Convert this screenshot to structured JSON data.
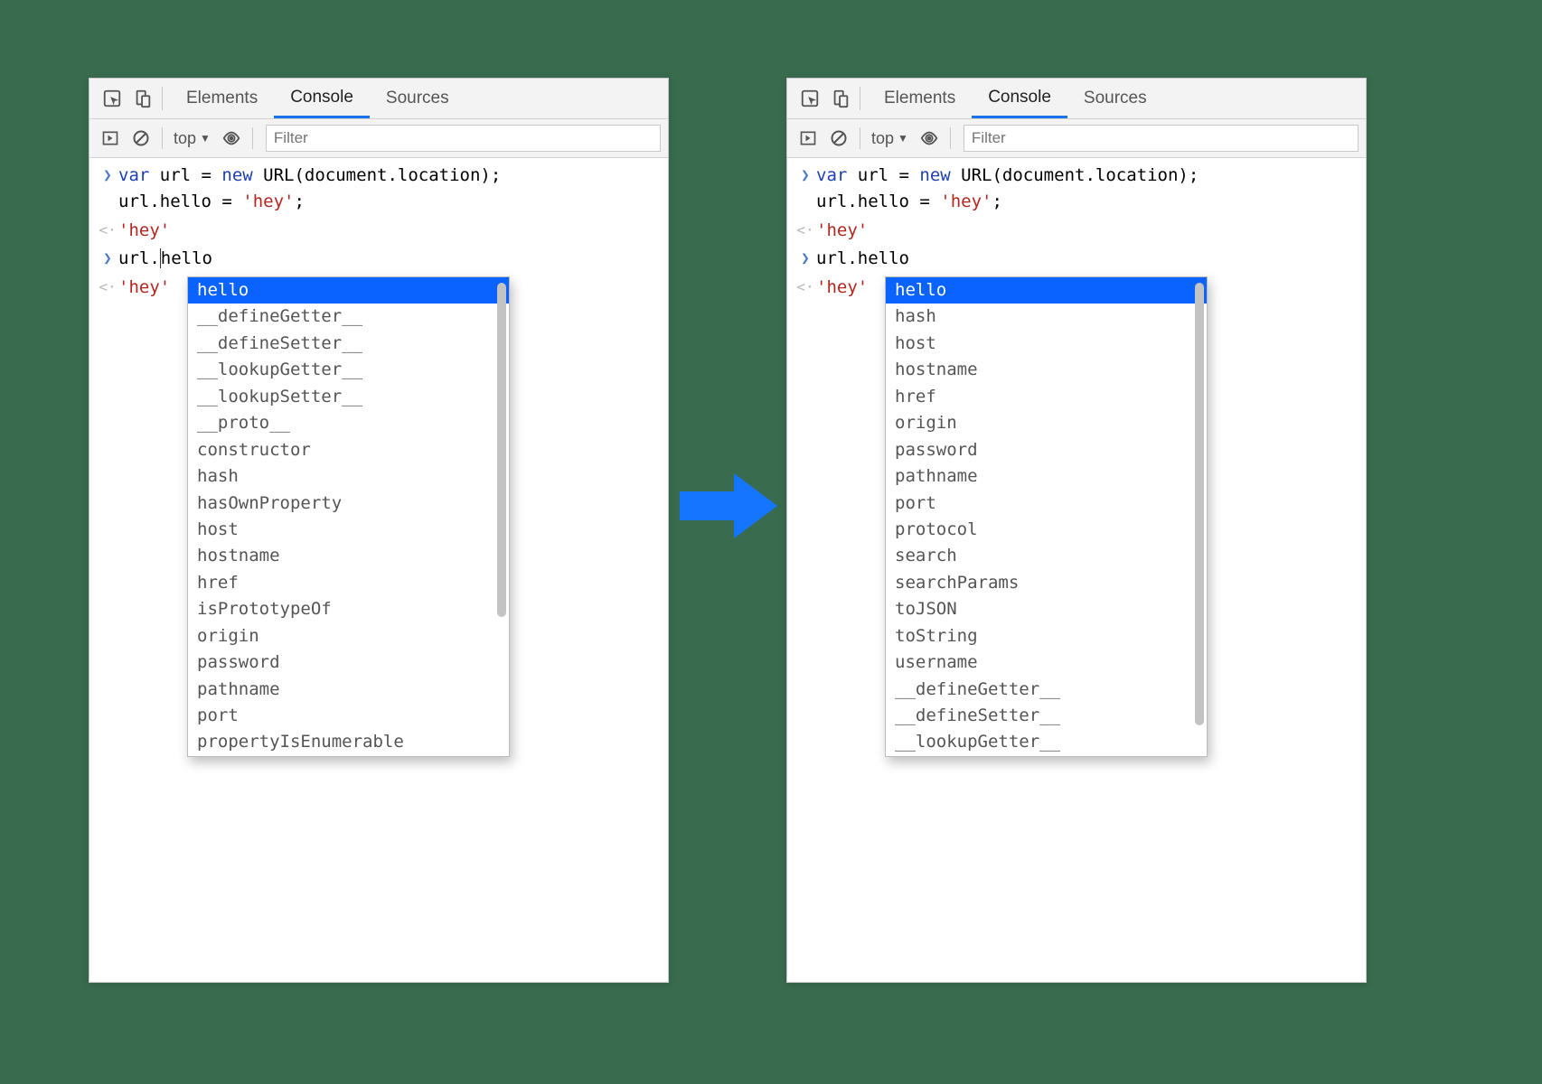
{
  "tabs": {
    "elements": "Elements",
    "console": "Console",
    "sources": "Sources"
  },
  "filter": {
    "context": "top",
    "placeholder": "Filter"
  },
  "code": {
    "line1a": "var",
    "line1b": " url = ",
    "line1c": "new",
    "line1d": " URL(document.location);",
    "line2": "url.hello = ",
    "line2str": "'hey'",
    "line2end": ";",
    "return1": "'hey'",
    "prompt2_left": "url.",
    "prompt2_right_left": "hello",
    "prompt2_right_right": "hello",
    "return2": "'hey'"
  },
  "autocomplete_left": [
    "hello",
    "__defineGetter__",
    "__defineSetter__",
    "__lookupGetter__",
    "__lookupSetter__",
    "__proto__",
    "constructor",
    "hash",
    "hasOwnProperty",
    "host",
    "hostname",
    "href",
    "isPrototypeOf",
    "origin",
    "password",
    "pathname",
    "port",
    "propertyIsEnumerable"
  ],
  "autocomplete_right": [
    "hello",
    "hash",
    "host",
    "hostname",
    "href",
    "origin",
    "password",
    "pathname",
    "port",
    "protocol",
    "search",
    "searchParams",
    "toJSON",
    "toString",
    "username",
    "__defineGetter__",
    "__defineSetter__",
    "__lookupGetter__"
  ]
}
